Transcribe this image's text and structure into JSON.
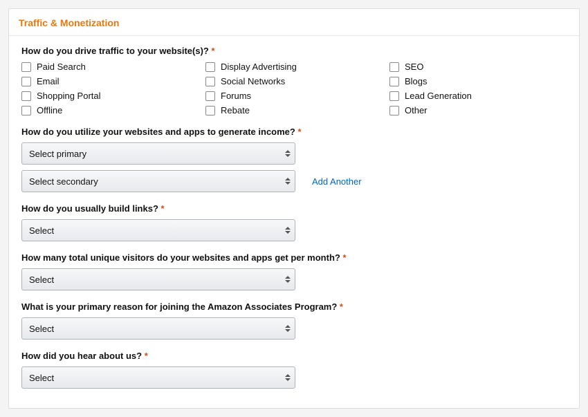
{
  "panelTitle": "Traffic & Monetization",
  "required": "*",
  "questions": {
    "traffic": "How do you drive traffic to your website(s)?",
    "income": "How do you utilize your websites and apps to generate income?",
    "links": "How do you usually build links?",
    "visitors": "How many total unique visitors do your websites and apps get per month?",
    "reason": "What is your primary reason for joining the Amazon Associates Program?",
    "hear": "How did you hear about us?"
  },
  "trafficOptions": {
    "c1": "Paid Search",
    "c2": "Display Advertising",
    "c3": "SEO",
    "c4": "Email",
    "c5": "Social Networks",
    "c6": "Blogs",
    "c7": "Shopping Portal",
    "c8": "Forums",
    "c9": "Lead Generation",
    "c10": "Offline",
    "c11": "Rebate",
    "c12": "Other"
  },
  "selects": {
    "incomePrimary": "Select primary",
    "incomeSecondary": "Select secondary",
    "linksVal": "Select",
    "visitorsVal": "Select",
    "reasonVal": "Select",
    "hearVal": "Select"
  },
  "addAnother": "Add Another"
}
